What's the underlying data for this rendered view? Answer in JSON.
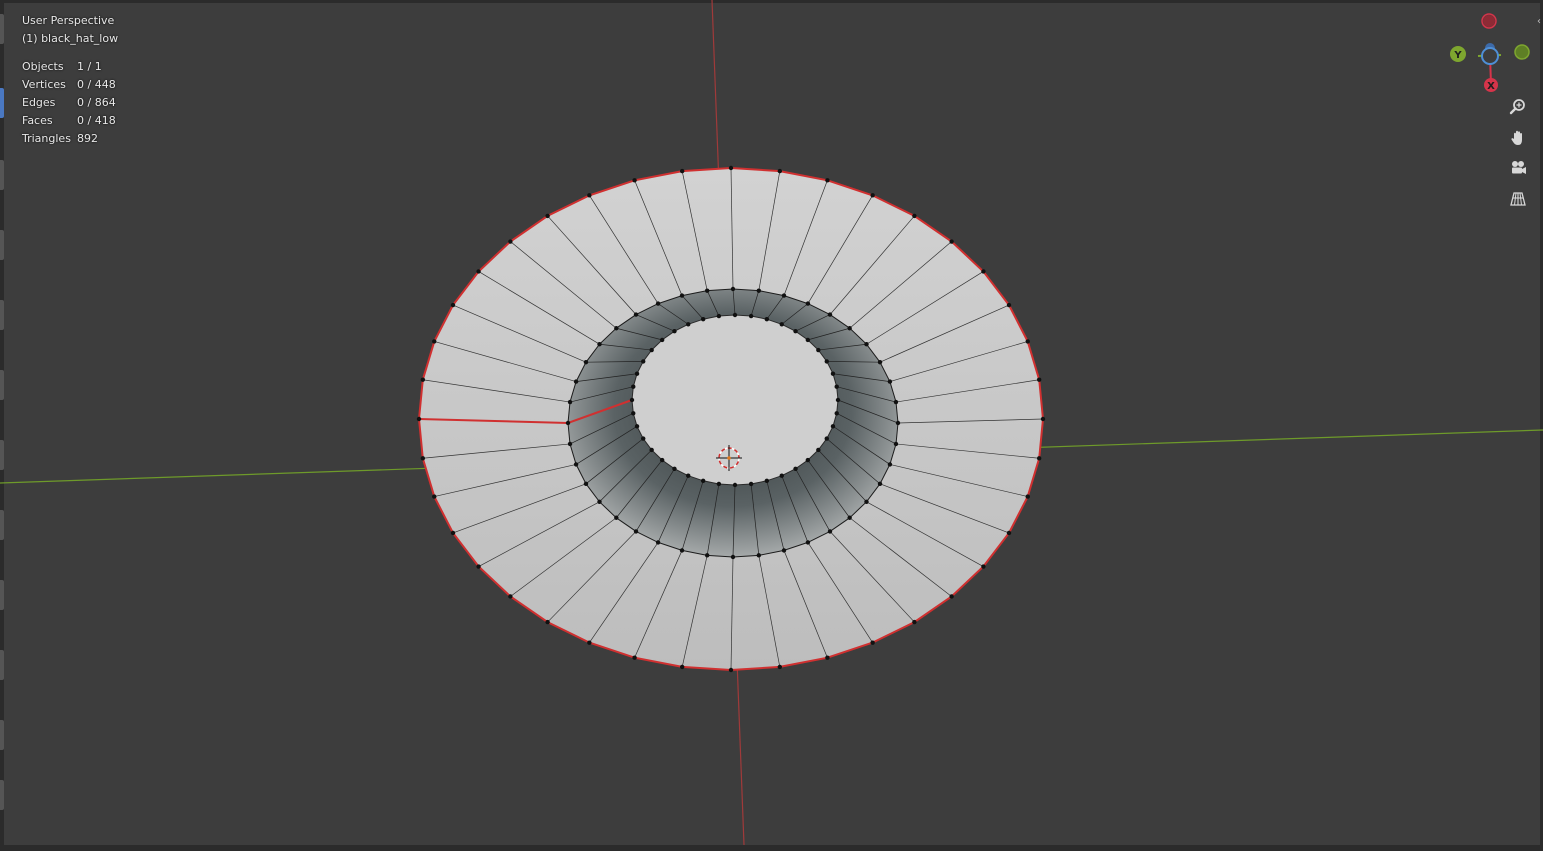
{
  "viewport": {
    "view_name": "User Perspective",
    "active_object": "(1) black_hat_low",
    "stats": [
      {
        "label": "Objects",
        "value": "1 / 1"
      },
      {
        "label": "Vertices",
        "value": "0 / 448"
      },
      {
        "label": "Edges",
        "value": "0 / 864"
      },
      {
        "label": "Faces",
        "value": "0 / 418"
      },
      {
        "label": "Triangles",
        "value": "892"
      }
    ]
  },
  "gizmo": {
    "axes": [
      {
        "label": "Y",
        "color": "#7ea62f"
      },
      {
        "label": "X",
        "color": "#d6344a"
      }
    ],
    "z_color": "#4e8fd6"
  },
  "nav_tools": [
    "zoom-icon",
    "pan-hand-icon",
    "camera-icon",
    "perspective-grid-icon"
  ],
  "colors": {
    "background": "#3d3d3d",
    "mesh_face": "#c9c9c9",
    "seam": "#d03030",
    "x_axis": "#a03a3a",
    "y_axis": "#6e9a2a"
  }
}
